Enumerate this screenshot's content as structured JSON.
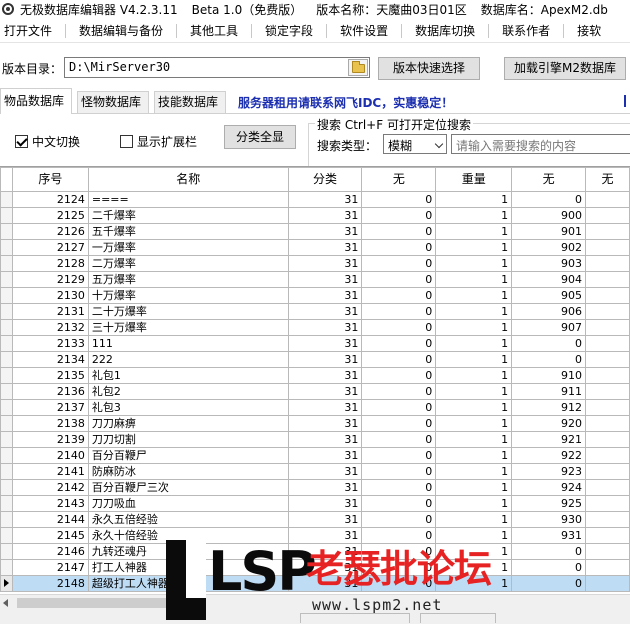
{
  "titlebar": {
    "app": "无极数据库编辑器 V4.2.3.11",
    "beta": "Beta 1.0（免费版）",
    "version": "版本名称：天魔曲03日01区",
    "db": "数据库名：ApexM2.db"
  },
  "menu": [
    "打开文件",
    "数据编辑与备份",
    "其他工具",
    "锁定字段",
    "软件设置",
    "数据库切换",
    "联系作者",
    "接软"
  ],
  "dir": {
    "label": "版本目录：",
    "value": "D:\\MirServer30",
    "quick_button": "版本快速选择",
    "load_button": "加载引擎M2数据库"
  },
  "tabs": [
    "物品数据库",
    "怪物数据库",
    "技能数据库"
  ],
  "notice": "服务器租用请联系网飞IDC，实惠稳定！",
  "options": {
    "chinese_switch": "中文切换",
    "show_extended": "显示扩展栏",
    "category_all": "分类全显"
  },
  "search": {
    "title": "搜索  Ctrl+F 可打开定位搜索",
    "type_label": "搜索类型：",
    "type_value": "模糊",
    "placeholder": "请输入需要搜索的内容"
  },
  "grid": {
    "columns": [
      "序号",
      "名称",
      "分类",
      "无",
      "重量",
      "无",
      "无"
    ],
    "rows": [
      [
        "2124",
        "====",
        "31",
        "0",
        "1",
        "0"
      ],
      [
        "2125",
        "二千爆率",
        "31",
        "0",
        "1",
        "900"
      ],
      [
        "2126",
        "五千爆率",
        "31",
        "0",
        "1",
        "901"
      ],
      [
        "2127",
        "一万爆率",
        "31",
        "0",
        "1",
        "902"
      ],
      [
        "2128",
        "二万爆率",
        "31",
        "0",
        "1",
        "903"
      ],
      [
        "2129",
        "五万爆率",
        "31",
        "0",
        "1",
        "904"
      ],
      [
        "2130",
        "十万爆率",
        "31",
        "0",
        "1",
        "905"
      ],
      [
        "2131",
        "二十万爆率",
        "31",
        "0",
        "1",
        "906"
      ],
      [
        "2132",
        "三十万爆率",
        "31",
        "0",
        "1",
        "907"
      ],
      [
        "2133",
        "111",
        "31",
        "0",
        "1",
        "0"
      ],
      [
        "2134",
        "222",
        "31",
        "0",
        "1",
        "0"
      ],
      [
        "2135",
        "礼包1",
        "31",
        "0",
        "1",
        "910"
      ],
      [
        "2136",
        "礼包2",
        "31",
        "0",
        "1",
        "911"
      ],
      [
        "2137",
        "礼包3",
        "31",
        "0",
        "1",
        "912"
      ],
      [
        "2138",
        "刀刀麻痹",
        "31",
        "0",
        "1",
        "920"
      ],
      [
        "2139",
        "刀刀切割",
        "31",
        "0",
        "1",
        "921"
      ],
      [
        "2140",
        "百分百鞭尸",
        "31",
        "0",
        "1",
        "922"
      ],
      [
        "2141",
        "防麻防冰",
        "31",
        "0",
        "1",
        "923"
      ],
      [
        "2142",
        "百分百鞭尸三次",
        "31",
        "0",
        "1",
        "924"
      ],
      [
        "2143",
        "刀刀吸血",
        "31",
        "0",
        "1",
        "925"
      ],
      [
        "2144",
        "永久五倍经验",
        "31",
        "0",
        "1",
        "930"
      ],
      [
        "2145",
        "永久十倍经验",
        "31",
        "0",
        "1",
        "931"
      ],
      [
        "2146",
        "九转还魂丹",
        "31",
        "0",
        "1",
        "0"
      ],
      [
        "2147",
        "打工人神器",
        "31",
        "0",
        "1",
        "0"
      ],
      [
        "2148",
        "超级打工人神器",
        "31",
        "0",
        "1",
        "0"
      ]
    ],
    "selected_row": "2148"
  },
  "watermark": {
    "brand": "LSP",
    "name": "老瑟批论坛",
    "url": "www.lspm2.net"
  }
}
